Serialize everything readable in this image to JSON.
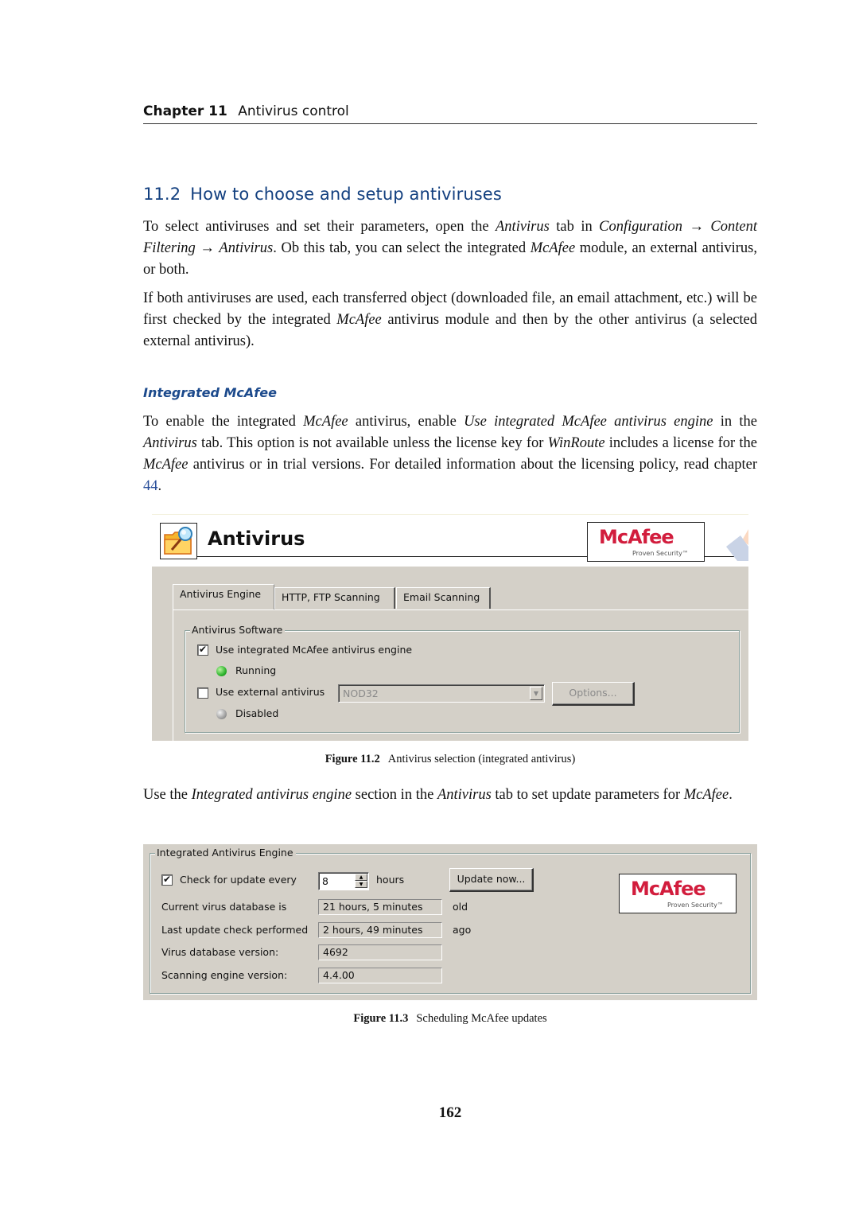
{
  "header": {
    "chapter_label": "Chapter 11",
    "chapter_title": "Antivirus control"
  },
  "section": {
    "number": "11.2",
    "title": "How to choose and setup antiviruses"
  },
  "paragraphs": {
    "p1": {
      "t1": "To select antiviruses and set their parameters, open the ",
      "i1": "Antivirus",
      "t2": " tab in ",
      "i2": "Configuration",
      "arrow": " → ",
      "i3": "Content Filtering",
      "arrow2": " → ",
      "i4": "Antivirus",
      "t3": ". Ob this tab, you can select the integrated ",
      "i5": "McAfee",
      "t4": " module, an external antivirus, or both."
    },
    "p2": {
      "t1": "If both antiviruses are used, each transferred object (downloaded file, an email attachment, etc.) will be first checked by the integrated ",
      "i1": "McAfee",
      "t2": " antivirus module and then by the other antivirus (a selected external antivirus)."
    },
    "subsection_title": "Integrated McAfee",
    "p3": {
      "t1": "To enable the integrated ",
      "i1": "McAfee",
      "t2": " antivirus, enable ",
      "i2": "Use integrated McAfee antivirus engine",
      "t3": " in the ",
      "i3": "Antivirus",
      "t4": " tab.  This option is not available unless the license key for ",
      "i4": "WinRoute",
      "t5": " includes a license for the ",
      "i5": "McAfee",
      "t6": " antivirus or in trial versions. For detailed information about the licensing policy, read chapter ",
      "link": "44",
      "t7": "."
    },
    "p4": {
      "t1": "Use the ",
      "i1": "Integrated antivirus engine",
      "t2": " section in the ",
      "i2": "Antivirus",
      "t3": " tab to set update parameters for ",
      "i3": "McAfee",
      "t4": "."
    }
  },
  "figure1": {
    "title": "Antivirus",
    "icon": "folder-magnifier-icon",
    "logo": {
      "word": "McAfee",
      "mark": "®",
      "tagline": "Proven Security™",
      "color": "#d21d3d"
    },
    "tabs": [
      {
        "label": "Antivirus Engine",
        "active": true
      },
      {
        "label": "HTTP, FTP Scanning",
        "active": false
      },
      {
        "label": "Email Scanning",
        "active": false
      }
    ],
    "group_title": "Antivirus Software",
    "integrated": {
      "label": "Use integrated McAfee antivirus engine",
      "checked": true,
      "status": "Running",
      "status_color": "#2db42d"
    },
    "external": {
      "label": "Use external antivirus",
      "checked": false,
      "selected": "NOD32",
      "options_label": "Options...",
      "status": "Disabled",
      "status_color": "#a0a0a0"
    },
    "caption_label": "Figure 11.2",
    "caption_text": "Antivirus selection (integrated antivirus)"
  },
  "figure2": {
    "group_title": "Integrated Antivirus Engine",
    "check_update": {
      "label": "Check for update every",
      "checked": true,
      "value": "8",
      "unit": "hours"
    },
    "update_now_label": "Update now...",
    "rows": [
      {
        "label": "Current virus database is",
        "value": "21 hours, 5 minutes",
        "suffix": "old"
      },
      {
        "label": "Last update check performed",
        "value": "2 hours, 49 minutes",
        "suffix": "ago"
      },
      {
        "label": "Virus database version:",
        "value": "4692",
        "suffix": ""
      },
      {
        "label": "Scanning engine version:",
        "value": "4.4.00",
        "suffix": ""
      }
    ],
    "logo": {
      "word": "McAfee",
      "mark": "®",
      "tagline": "Proven Security™"
    },
    "caption_label": "Figure 11.3",
    "caption_text": "Scheduling McAfee updates"
  },
  "page_number": "162",
  "glyphs": {
    "check": "✔",
    "up": "▲",
    "down": "▼"
  }
}
